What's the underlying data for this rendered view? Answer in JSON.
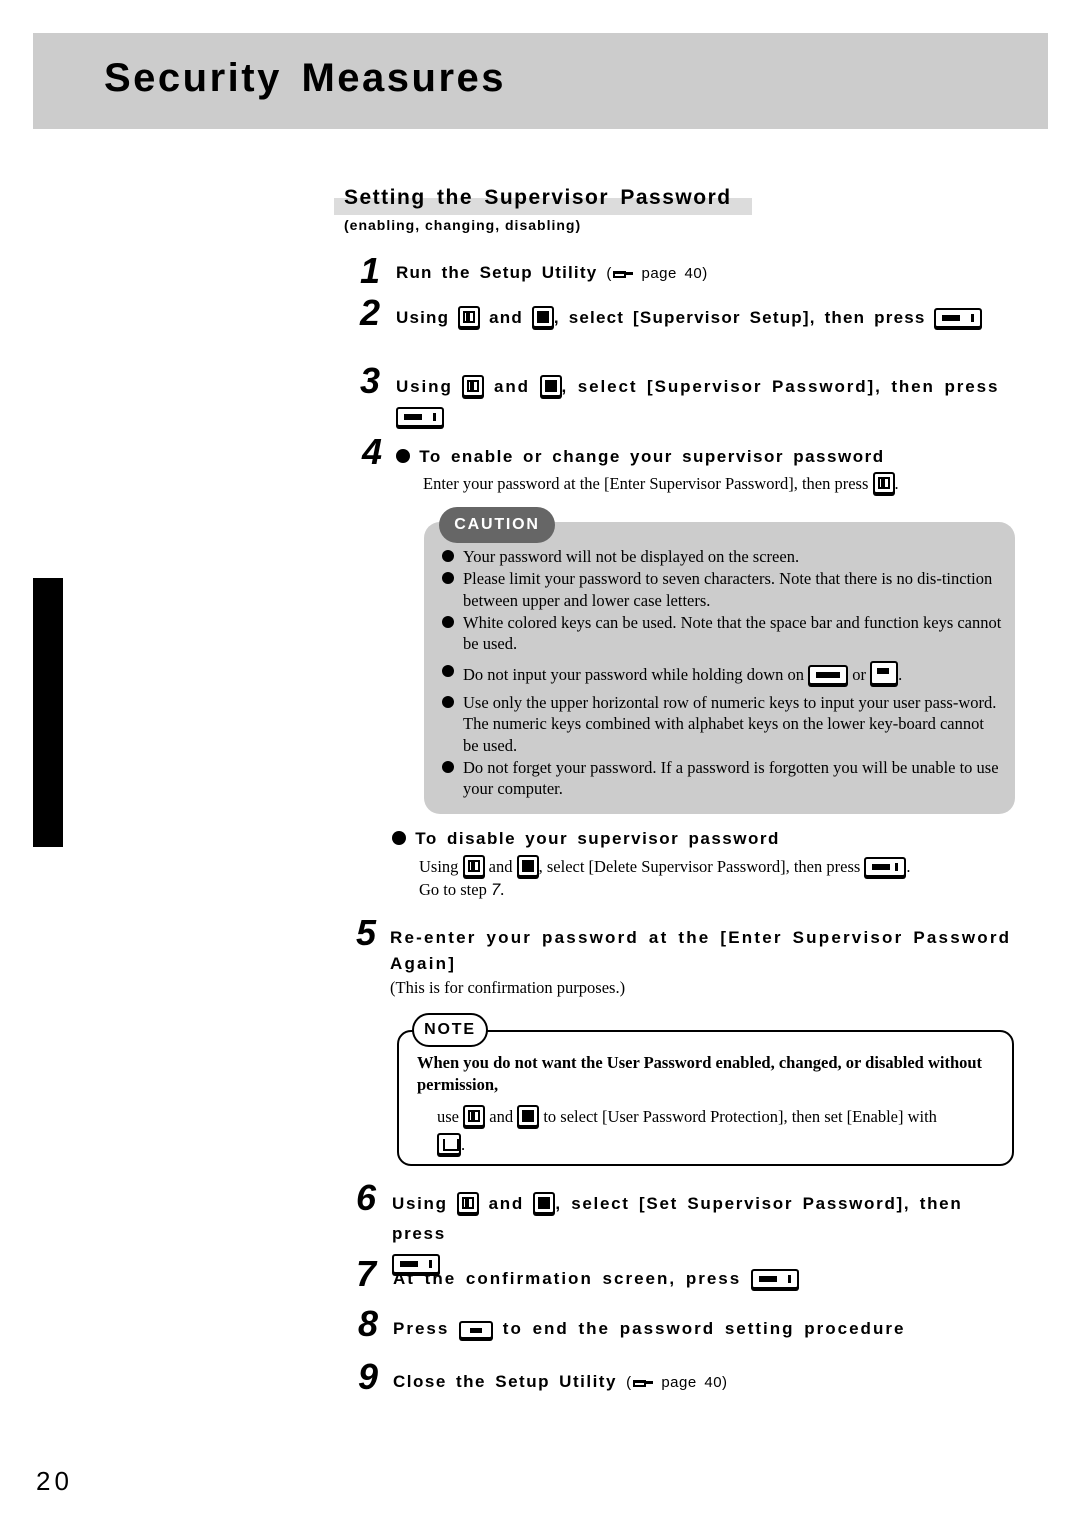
{
  "header": {
    "title": "Security Measures"
  },
  "section": {
    "title": "Setting the Supervisor Password",
    "subtitle": "(enabling, changing, disabling)"
  },
  "steps": [
    {
      "num": "1",
      "text": "Run the Setup Utility",
      "ref_open": "(",
      "ref_page": "page 40)"
    },
    {
      "num": "2",
      "pre": "Using",
      "and": "and",
      "post": ", select [Supervisor Setup], then press"
    },
    {
      "num": "3",
      "pre": "Using",
      "and": "and",
      "post": ", select [Supervisor Password], then press"
    },
    {
      "num": "4"
    },
    {
      "num": "5",
      "line1": "Re-enter your password at the [Enter Supervisor Password",
      "line2": "Again]",
      "note": "(This is for confirmation purposes.)"
    },
    {
      "num": "6",
      "pre": "Using",
      "and": "and",
      "post": ", select [Set Supervisor Password], then press"
    },
    {
      "num": "7",
      "text": "At the confirmation screen, press"
    },
    {
      "num": "8",
      "pre": "Press",
      "post": "to end the password setting procedure"
    },
    {
      "num": "9",
      "text": "Close the Setup Utility",
      "ref_open": "(",
      "ref_page": "page 40)"
    }
  ],
  "enable": {
    "heading": "To enable or change your supervisor password",
    "text": "Enter your password at the [Enter Supervisor Password], then press",
    "end": "."
  },
  "caution": {
    "label": "CAUTION",
    "items": [
      "Your password will not be displayed on the screen.",
      "Please limit your password to seven characters.  Note that there is no dis-tinction between upper and lower case letters.",
      "White colored keys can be used. Note that the space bar and function keys cannot be used.",
      "Do not input your password while holding down on",
      "Use only the upper horizontal row of numeric keys to input your user pass-word. The numeric keys combined with alphabet keys on the lower key-board cannot be used.",
      "Do not forget your password.  If a password is forgotten you will be unable to use your computer."
    ],
    "item4_or": "or",
    "item4_end": "."
  },
  "disable": {
    "heading": "To disable your supervisor password",
    "pre": "Using",
    "and": "and",
    "post": ", select [Delete Supervisor Password], then press",
    "end": ".",
    "goto_pre": "Go to step",
    "goto_step": "7",
    "goto_end": "."
  },
  "note": {
    "label": "NOTE",
    "bold": "When you do not want the User Password enabled, changed, or disabled without permission,",
    "pre": "use",
    "and": "and",
    "post": "to select [User Password Protection], then set [Enable] with",
    "end": "."
  },
  "footer": {
    "page_number": "20"
  },
  "icons": {
    "up_key": "up-arrow-key-icon",
    "down_key": "down-arrow-key-icon",
    "enter_key": "enter-key-icon",
    "shift_key": "shift-key-icon",
    "ctrl_key": "ctrl-key-icon",
    "esc_key": "esc-key-icon",
    "space_key": "space-key-icon",
    "ref": "pointing-hand-icon"
  },
  "colors": {
    "header_band": "#cccccc",
    "caution_box": "#cccccc",
    "caution_tab": "#666666"
  }
}
